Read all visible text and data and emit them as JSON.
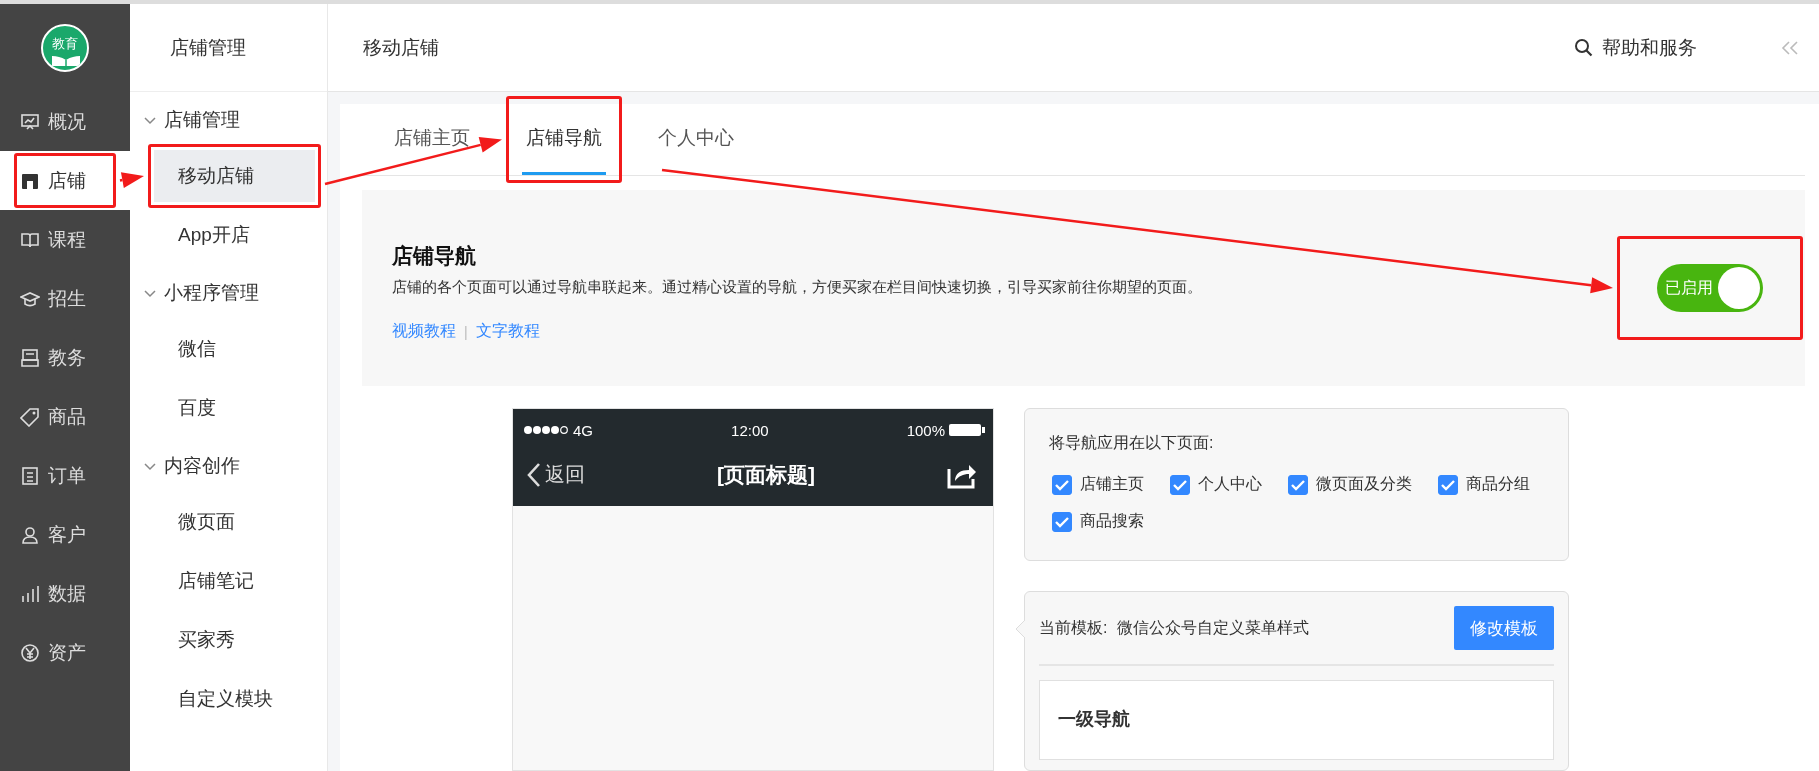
{
  "app_logo": {
    "text": "教育"
  },
  "main_nav": [
    {
      "label": "概况",
      "selected": false,
      "highlighted": false
    },
    {
      "label": "店铺",
      "selected": true,
      "highlighted": true
    },
    {
      "label": "课程",
      "selected": false,
      "highlighted": false
    },
    {
      "label": "招生",
      "selected": false,
      "highlighted": false
    },
    {
      "label": "教务",
      "selected": false,
      "highlighted": false
    },
    {
      "label": "商品",
      "selected": false,
      "highlighted": false
    },
    {
      "label": "订单",
      "selected": false,
      "highlighted": false
    },
    {
      "label": "客户",
      "selected": false,
      "highlighted": false
    },
    {
      "label": "数据",
      "selected": false,
      "highlighted": false
    },
    {
      "label": "资产",
      "selected": false,
      "highlighted": false
    }
  ],
  "sub_nav": {
    "title": "店铺管理",
    "groups": [
      {
        "label": "店铺管理",
        "expanded": true,
        "children": [
          {
            "label": "移动店铺",
            "selected": true,
            "highlighted": true
          },
          {
            "label": "App开店",
            "selected": false,
            "highlighted": false
          }
        ]
      },
      {
        "label": "小程序管理",
        "expanded": true,
        "children": [
          {
            "label": "微信",
            "selected": false,
            "highlighted": false
          },
          {
            "label": "百度",
            "selected": false,
            "highlighted": false
          }
        ]
      },
      {
        "label": "内容创作",
        "expanded": true,
        "children": [
          {
            "label": "微页面",
            "selected": false,
            "highlighted": false
          },
          {
            "label": "店铺笔记",
            "selected": false,
            "highlighted": false
          },
          {
            "label": "买家秀",
            "selected": false,
            "highlighted": false
          },
          {
            "label": "自定义模块",
            "selected": false,
            "highlighted": false
          }
        ]
      }
    ]
  },
  "header": {
    "title": "移动店铺",
    "help": "帮助和服务"
  },
  "tabs": [
    {
      "label": "店铺主页",
      "selected": false,
      "highlighted": false
    },
    {
      "label": "店铺导航",
      "selected": true,
      "highlighted": true
    },
    {
      "label": "个人中心",
      "selected": false,
      "highlighted": false
    }
  ],
  "feature": {
    "title": "店铺导航",
    "description": "店铺的各个页面可以通过导航串联起来。通过精心设置的导航，方便买家在栏目间快速切换，引导买家前往你期望的页面。",
    "links": [
      "视频教程",
      "文字教程"
    ],
    "separator": "|",
    "toggle": {
      "label": "已启用",
      "on": true,
      "highlighted": true
    }
  },
  "phone": {
    "carrier": "4G",
    "time": "12:00",
    "battery": "100%",
    "back": "返回",
    "title": "[页面标题]"
  },
  "apply_panel": {
    "label": "将导航应用在以下页面:",
    "options": [
      {
        "label": "店铺主页",
        "checked": true
      },
      {
        "label": "个人中心",
        "checked": true
      },
      {
        "label": "微页面及分类",
        "checked": true
      },
      {
        "label": "商品分组",
        "checked": true
      },
      {
        "label": "商品搜索",
        "checked": true
      }
    ]
  },
  "template_panel": {
    "label": "当前模板:",
    "value": "微信公众号自定义菜单样式",
    "button": "修改模板",
    "section_title": "一级导航"
  }
}
